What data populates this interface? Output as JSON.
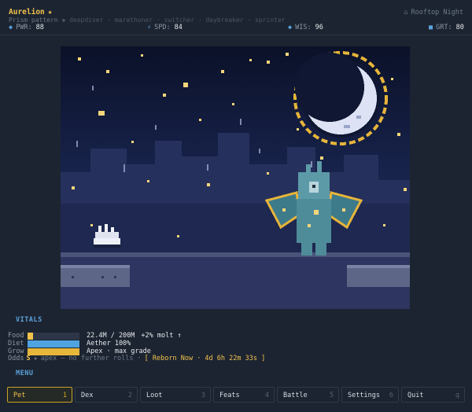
{
  "header": {
    "pet_name": "Aurelion",
    "star": "★",
    "location": "Rooftop Night",
    "location_icon": "home-icon",
    "traits": {
      "first": "Prism pattern",
      "rest": "◆ deepdiver · marathoner · switcher · daybreaker · sprinter"
    },
    "stats": [
      {
        "icon": "diamond-icon",
        "label": "PWR:",
        "value": "88"
      },
      {
        "icon": "bolt-icon",
        "label": "SPD:",
        "value": "84"
      },
      {
        "icon": "diamond-icon",
        "label": "WIS:",
        "value": "96"
      },
      {
        "icon": "square-icon",
        "label": "GRT:",
        "value": "80"
      }
    ]
  },
  "vitals": {
    "title": "VITALS",
    "rows": [
      {
        "label": "Food",
        "value": "22.4M / 200M",
        "extra": "+2% molt ↑",
        "fill": 0.112,
        "color": "#f2c14e"
      },
      {
        "label": "Diet",
        "value": "Aether 100%",
        "extra": "",
        "fill": 1.0,
        "color": "#4fa3e0"
      },
      {
        "label": "Grow",
        "value": "Apex · max grade",
        "extra": "",
        "fill": 1.0,
        "color": "#e7b73c"
      }
    ],
    "odds": {
      "label": "Odds",
      "grade": "S",
      "star": "★",
      "apex_text": "apex — no further rolls ·",
      "reborn": "[ Reborn Now · 4d 6h 22m 33s ]"
    }
  },
  "menu": {
    "title": "MENU",
    "items": [
      {
        "label": "Pet",
        "key": "1"
      },
      {
        "label": "Dex",
        "key": "2"
      },
      {
        "label": "Loot",
        "key": "3"
      },
      {
        "label": "Feats",
        "key": "4"
      },
      {
        "label": "Battle",
        "key": "5"
      },
      {
        "label": "Settings",
        "key": "6"
      },
      {
        "label": "Quit",
        "key": "q"
      }
    ],
    "active_index": 0
  },
  "colors": {
    "accent": "#f2c14e",
    "section": "#5ba3d9",
    "background": "#1c2431"
  }
}
